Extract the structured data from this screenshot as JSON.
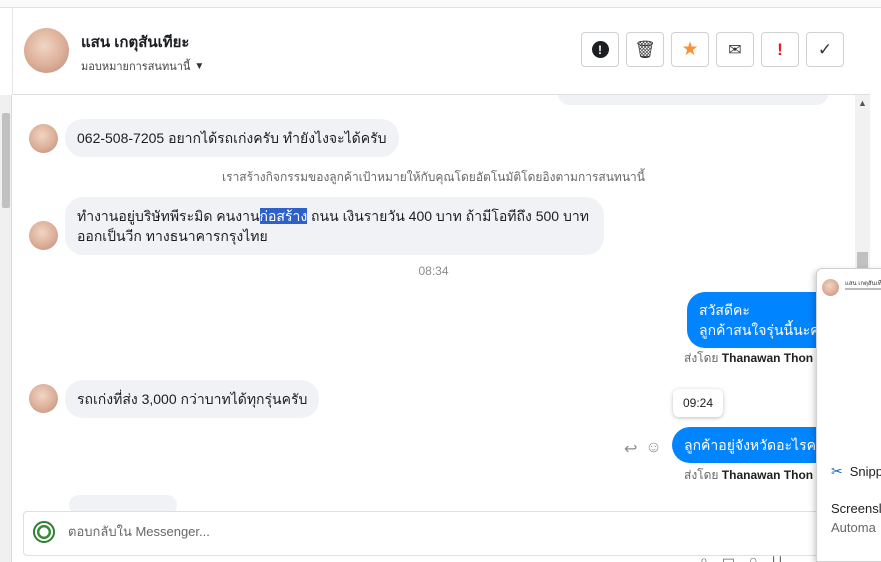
{
  "header": {
    "contact_name": "แสน เกตุสันเทียะ",
    "assign_label": "มอบหมายการสนทนานี้"
  },
  "actions": [
    {
      "name": "mark-spam-button",
      "icon": "warning-circle-icon"
    },
    {
      "name": "delete-button",
      "icon": "trash-icon"
    },
    {
      "name": "star-button",
      "icon": "star-icon",
      "color": "#f7923a"
    },
    {
      "name": "mark-unread-button",
      "icon": "envelope-icon"
    },
    {
      "name": "follow-up-button",
      "icon": "exclamation-icon",
      "color": "#e02020"
    },
    {
      "name": "mark-done-button",
      "icon": "check-icon"
    }
  ],
  "messages": {
    "m1": "062-508-7205 อยากได้รถเก่งครับ ทำยังไงจะได้ครับ",
    "system_note": "เราสร้างกิจกรรมของลูกค้าเป้าหมายให้กับคุณโดยอัตโนมัติโดยอิงตามการสนทนานี้",
    "m2_before": "ทำงานอยู่บริษัทพีระมิด คนงาน",
    "m2_highlight": "ก่อสร้าง",
    "m2_after": " ถนน เงินรายวัน 400 บาท ถ้ามีโอทีถึง 500 บาท",
    "m2_line2": "ออกเป็นวีก ทางธนาคารกรุงไทย",
    "time1": "08:34",
    "out1_line1": "สวัสดีคะ",
    "out1_line2": "ลูกค้าสนใจรุ่นนี้นะคะ",
    "sent_by_label": "ส่งโดย",
    "sender": "Thanawan Thon",
    "m3": "รถเก่งที่ส่ง 3,000 กว่าบาทได้ทุกรุ่นครับ",
    "tooltip_time": "09:24",
    "out2": "ลูกค้าอยู่จังหวัดอะไรคะ"
  },
  "composer": {
    "placeholder": "ตอบกลับใน Messenger..."
  },
  "popup": {
    "snip_label": "Snipp",
    "title": "Screensl",
    "desc": "Automa"
  },
  "colors": {
    "outgoing_bubble": "#0084ff",
    "incoming_bubble": "#f0f2f5",
    "text_highlight": "#2d61c9"
  }
}
